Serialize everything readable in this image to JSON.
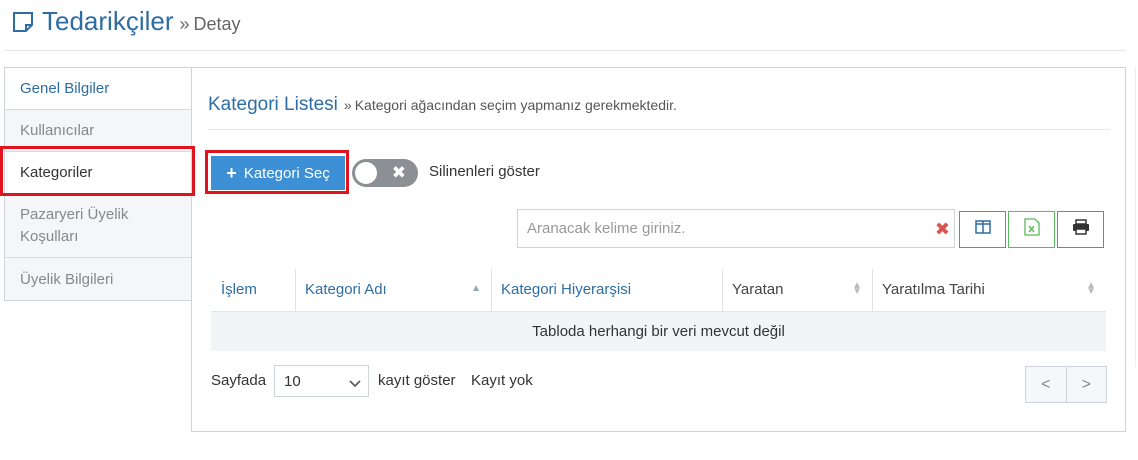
{
  "header": {
    "title": "Tedarikçiler",
    "separator": "»",
    "subtitle": "Detay",
    "icon": "document-icon"
  },
  "sidebar": {
    "items": [
      {
        "label": "Genel Bilgiler"
      },
      {
        "label": "Kullanıcılar"
      },
      {
        "label": "Kategoriler",
        "active": true
      },
      {
        "label": "Pazaryeri Üyelik Koşulları"
      },
      {
        "label": "Üyelik Bilgileri"
      }
    ]
  },
  "panel": {
    "title": "Kategori Listesi",
    "separator": "»",
    "hint": "Kategori ağacından seçim yapmanız gerekmektedir.",
    "add_button": {
      "label": "Kategori Seç",
      "plus": "+"
    },
    "toggle": {
      "label": "Silinenleri göster",
      "x": "✖",
      "checked": false
    },
    "search": {
      "placeholder": "Aranacak kelime giriniz.",
      "value": "",
      "clear": "✖"
    },
    "tools": [
      "columns-icon",
      "excel-icon",
      "print-icon"
    ]
  },
  "table": {
    "columns": [
      "İşlem",
      "Kategori Adı",
      "Kategori Hiyerarşisi",
      "Yaratan",
      "Yaratılma Tarihi"
    ],
    "empty_text": "Tabloda herhangi bir veri mevcut değil"
  },
  "footer": {
    "per_page_prefix": "Sayfada",
    "per_page_value": "10",
    "per_page_suffix": "kayıt göster",
    "record_info": "Kayıt yok",
    "prev": "<",
    "next": ">"
  },
  "colors": {
    "accent": "#2e6da4",
    "button": "#3d8fd6",
    "highlight": "#e0141e",
    "excel": "#5cb85c"
  }
}
